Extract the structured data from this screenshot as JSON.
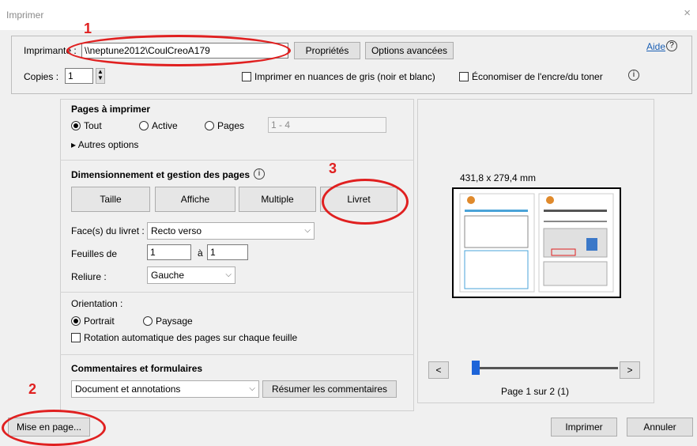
{
  "window": {
    "title": "Imprimer",
    "close": "×"
  },
  "printer": {
    "label": "Imprimante :",
    "value": "\\\\neptune2012\\CoulCreoA179",
    "properties": "Propriétés",
    "advanced": "Options avancées",
    "help": "Aide"
  },
  "copies": {
    "label": "Copies :",
    "value": "1",
    "grayscale": "Imprimer en nuances de gris (noir et blanc)",
    "save_ink": "Économiser de l'encre/du toner"
  },
  "pages": {
    "header": "Pages à imprimer",
    "all": "Tout",
    "current": "Active",
    "pages": "Pages",
    "range": "1 - 4",
    "more": "Autres options"
  },
  "sizing": {
    "header": "Dimensionnement et gestion des pages",
    "size": "Taille",
    "poster": "Affiche",
    "multiple": "Multiple",
    "booklet": "Livret",
    "sides_label": "Face(s) du livret :",
    "sides_value": "Recto verso",
    "sheets_label": "Feuilles de",
    "sheets_from": "1",
    "sheets_to_label": "à",
    "sheets_to": "1",
    "binding_label": "Reliure :",
    "binding_value": "Gauche"
  },
  "orientation": {
    "header": "Orientation :",
    "portrait": "Portrait",
    "landscape": "Paysage",
    "auto_rotate": "Rotation automatique des pages sur chaque feuille"
  },
  "comments": {
    "header": "Commentaires et formulaires",
    "value": "Document et annotations",
    "summarize": "Résumer les commentaires"
  },
  "preview": {
    "size": "431,8 x 279,4 mm",
    "page": "Page 1 sur 2 (1)",
    "prev": "<",
    "next": ">"
  },
  "footer": {
    "page_setup": "Mise en page...",
    "print": "Imprimer",
    "cancel": "Annuler"
  },
  "annotations": {
    "n1": "1",
    "n2": "2",
    "n3": "3"
  }
}
